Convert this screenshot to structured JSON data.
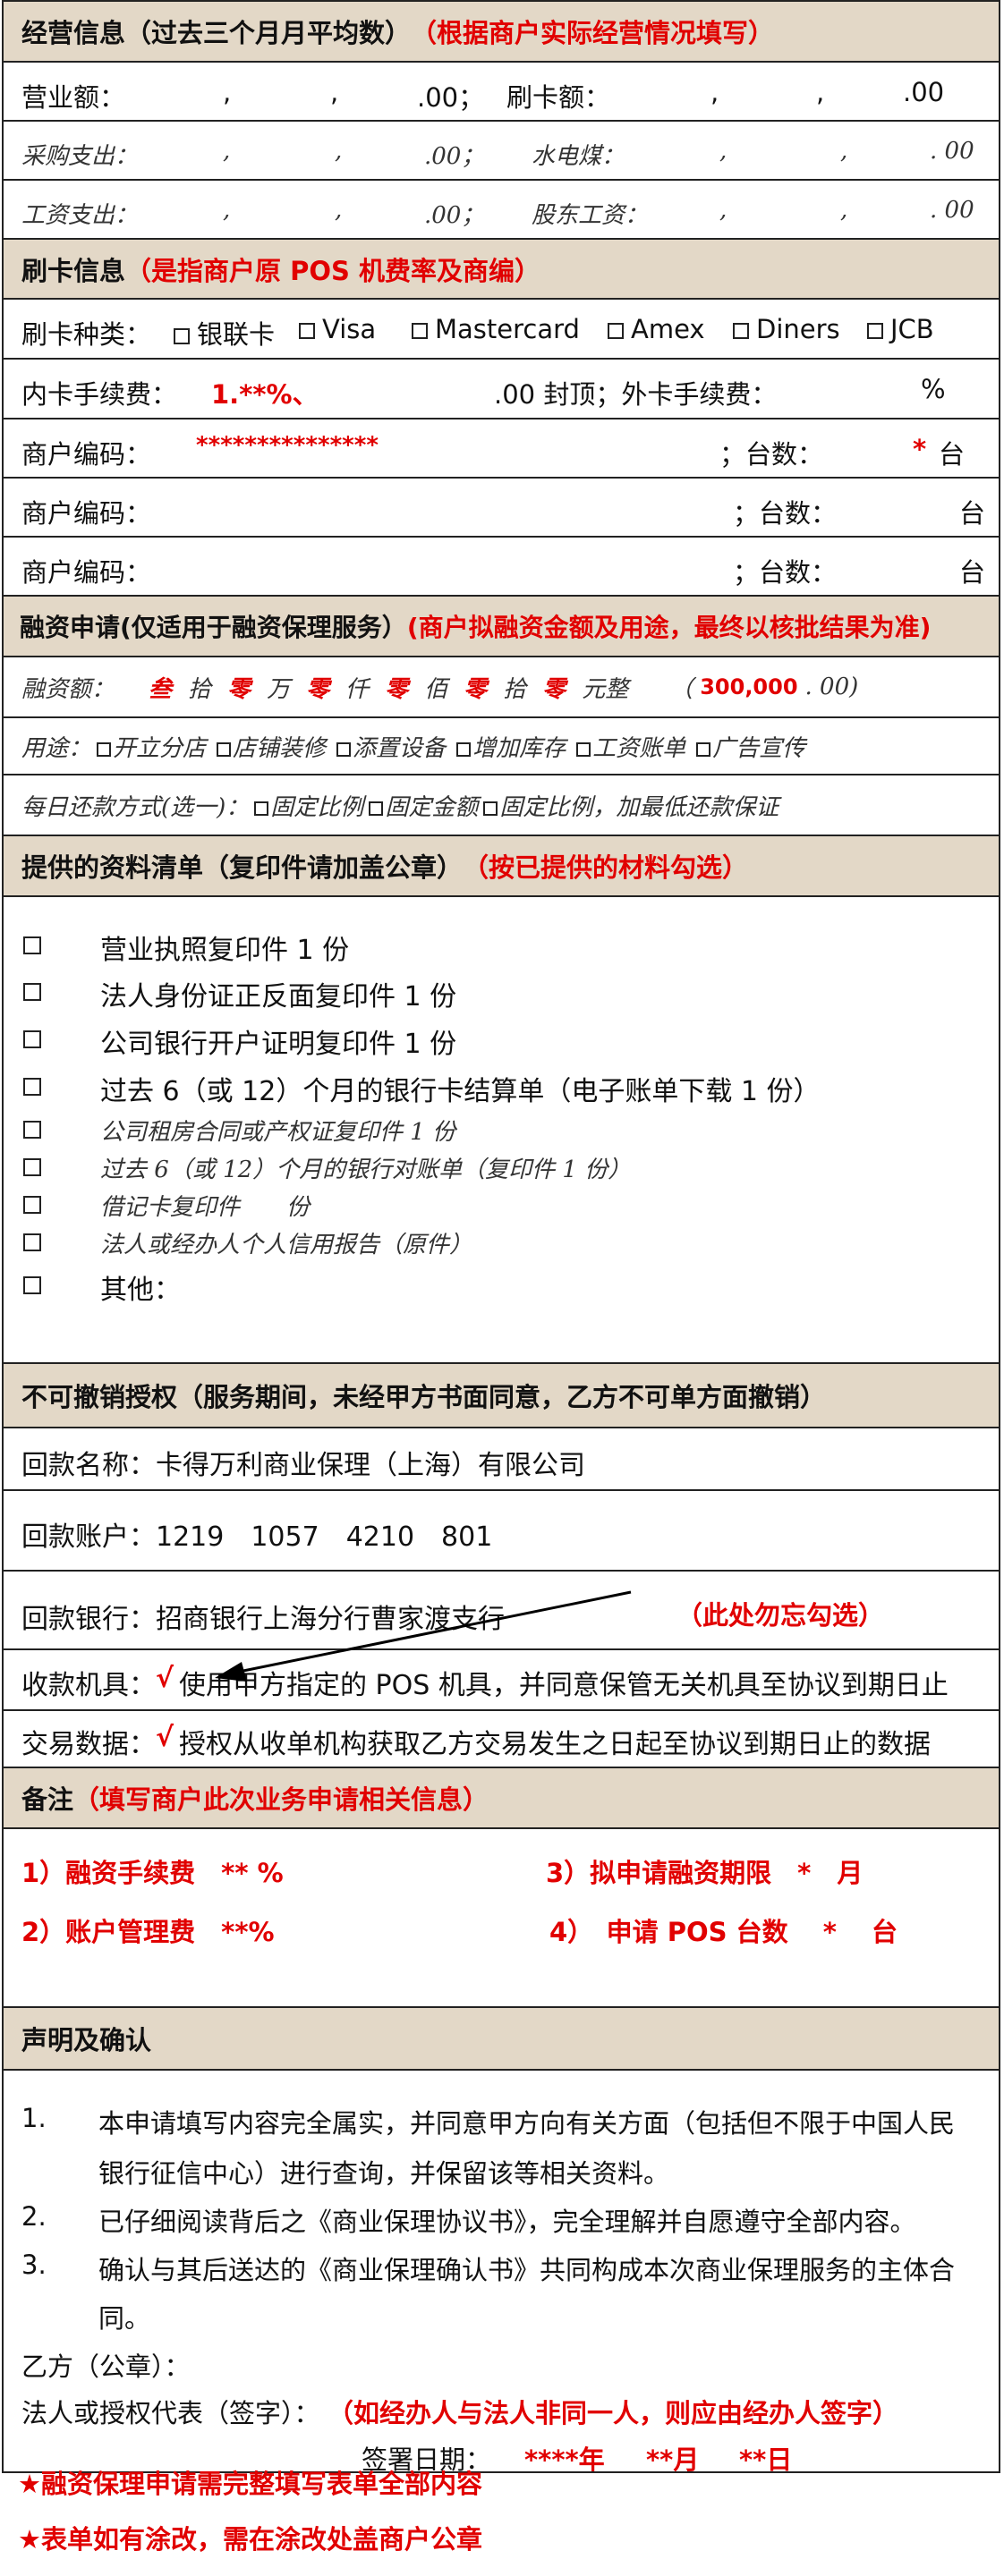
{
  "biz": {
    "header": "经营信息（过去三个月月平均数）",
    "header_red": "（根据商户实际经营情况填写）",
    "revenue_label": "营业额：",
    "card_label": "刷卡额：",
    "comma": ",",
    "yuan00": ".00",
    "yuan00_semi": ".00；",
    "purchase_label": "采购支出：",
    "utility_label": "水电煤：",
    "salary_label": "工资支出：",
    "shareholder_label": "股东工资：",
    "yuan00_semi_it": ".00；",
    "yuan00_it": ". 00"
  },
  "card": {
    "header": "刷卡信息",
    "header_red": "（是指商户原 POS 机费率及商编）",
    "kinds_label": "刷卡种类：",
    "kinds": [
      "银联卡",
      "Visa",
      "Mastercard",
      "Amex",
      "Diners",
      "JCB"
    ],
    "fee_label": "内卡手续费：",
    "fee_value": "1.**%、",
    "fee_cap": ".00 封顶；外卡手续费：",
    "fee_pct": "%",
    "merchant_label": "商户编码：",
    "merchant_value": "***************",
    "units_label": "；台数：",
    "units_star": "*",
    "units_unit": "台"
  },
  "finance": {
    "header": "融资申请(仅适用于融资保理服务）",
    "header_red": "(商户拟融资金额及用途，最终以核批结果为准)",
    "amount_label": "融资额：",
    "amount_parts": [
      {
        "v": "叁",
        "u": "拾"
      },
      {
        "v": "零",
        "u": "万"
      },
      {
        "v": "零",
        "u": "仟"
      },
      {
        "v": "零",
        "u": "佰"
      },
      {
        "v": "零",
        "u": "拾"
      },
      {
        "v": "零",
        "u": "元整"
      }
    ],
    "amount_num_open": "（",
    "amount_num": "300,000",
    "amount_num_close": ". 00)",
    "use_label": "用途：",
    "uses": [
      "开立分店",
      "店铺装修",
      "添置设备",
      "增加库存",
      "工资账单",
      "广告宣传"
    ],
    "repay_label": "每日还款方式(选一)：",
    "repays": [
      "固定比例",
      "固定金额",
      "固定比例，加最低还款保证"
    ]
  },
  "docs": {
    "header": "提供的资料清单（复印件请加盖公章）",
    "header_red": "（按已提供的材料勾选）",
    "items": [
      "营业执照复印件 1 份",
      "法人身份证正反面复印件 1 份",
      "公司银行开户证明复印件 1 份",
      "过去 6（或 12）个月的银行卡结算单（电子账单下载 1 份）"
    ],
    "items_it": [
      "公司租房合同或产权证复印件 1 份",
      "过去 6（或 12）个月的银行对账单（复印件 1 份）",
      "借记卡复印件　　份",
      "法人或经办人个人信用报告（原件）"
    ],
    "other": "其他："
  },
  "auth": {
    "header": "不可撤销授权（服务期间，未经甲方书面同意，乙方不可单方面撤销）",
    "payee_name": "回款名称：卡得万利商业保理（上海）有限公司",
    "payee_account": "回款账户：1219　1057　4210　801",
    "payee_bank": "回款银行：招商银行上海分行曹家渡支行",
    "dont_forget": "（此处勿忘勾选）",
    "collect_label": "收款机具：",
    "tick": "√",
    "collect_text": "使用甲方指定的 POS 机具，并同意保管无关机具至协议到期日止",
    "trade_label": "交易数据：",
    "trade_text": "授权从收单机构获取乙方交易发生之日起至协议到期日止的数据"
  },
  "remark": {
    "header": "备注",
    "header_red": "（填写商户此次业务申请相关信息）",
    "r1": "1）融资手续费　** %",
    "r2": "2）账户管理费　**%",
    "r3": "3）拟申请融资期限　*　月",
    "r4": "4）　申请 POS 台数　 *　 台"
  },
  "declare": {
    "header": "声明及确认",
    "items": [
      {
        "n": "1.",
        "lines": [
          "本申请填写内容完全属实，并同意甲方向有关方面（包括但不限于中国人民",
          "银行征信中心）进行查询，并保留该等相关资料。"
        ]
      },
      {
        "n": "2.",
        "lines": [
          "已仔细阅读背后之《商业保理协议书》，完全理解并自愿遵守全部内容。"
        ]
      },
      {
        "n": "3.",
        "lines": [
          "确认与其后送达的《商业保理确认书》共同构成本次商业保理服务的主体合",
          "同。"
        ]
      }
    ],
    "party_b": "乙方（公章）：",
    "legal_rep": "法人或授权代表（签字）：",
    "legal_rep_red": "（如经办人与法人非同一人，则应由经办人签字）",
    "sign_date": "签署日期：",
    "year": "****年",
    "month": "**月",
    "day": "**日"
  },
  "notes": [
    "★融资保理申请需完整填写表单全部内容",
    "★表单如有涂改，需在涂改处盖商户公章"
  ]
}
